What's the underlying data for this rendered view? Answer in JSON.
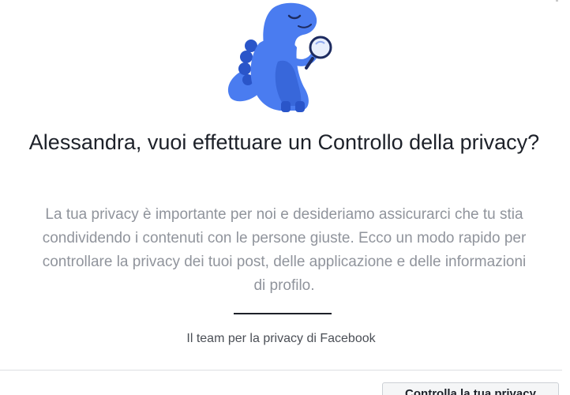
{
  "dialog": {
    "mascot_icon": "dinosaur-with-magnifying-glass-icon",
    "headline": "Alessandra, vuoi effettuare un Controllo della privacy?",
    "body": "La tua privacy è importante per noi e desideriamo assicurarci che tu stia condividendo i contenuti con le persone giuste. Ecco un modo rapido per controllare la privacy dei tuoi post, delle applicazione e delle informazioni di profilo.",
    "signature": "Il team per la privacy di Facebook",
    "primary_button_label": "Controlla la tua privacy"
  },
  "colors": {
    "headline": "#1d2129",
    "body": "#90949c",
    "mascot_blue": "#4a7cf0",
    "mascot_dark_blue": "#2a55c9"
  }
}
